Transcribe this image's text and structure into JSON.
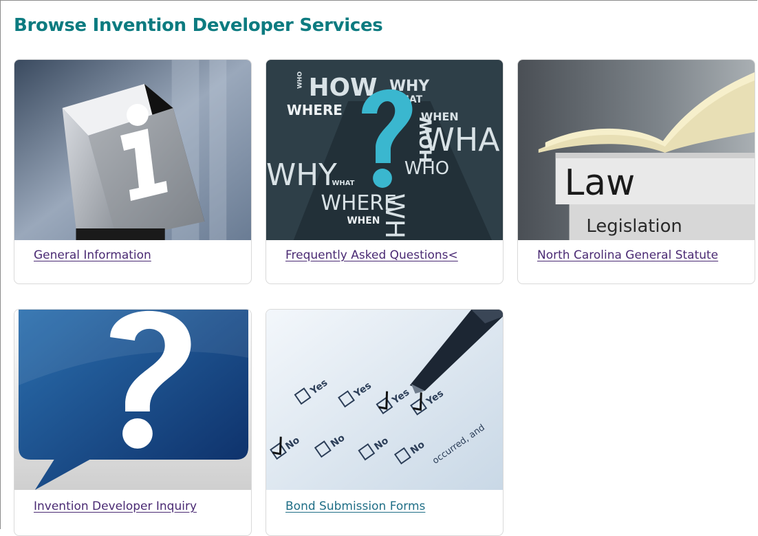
{
  "page": {
    "title": "Browse Invention Developer Services"
  },
  "cards": [
    {
      "label": "General Information",
      "image": "info-cube-image"
    },
    {
      "label": "Frequently Asked Questions<",
      "image": "question-word-cloud-image",
      "image_text": [
        "HOW",
        "WHY",
        "WHAT",
        "WHERE",
        "WHEN",
        "WHO",
        "WHY",
        "WHAT",
        "WHERE",
        "WHEN",
        "WHA",
        "HOW",
        "WHO"
      ]
    },
    {
      "label": "North Carolina General Statute",
      "image": "law-books-image",
      "image_text": [
        "Law",
        "Legislation"
      ]
    },
    {
      "label": "Invention Developer Inquiry",
      "image": "question-speech-bubble-image"
    },
    {
      "label": "Bond Submission Forms",
      "image": "checklist-form-pen-image",
      "image_text": [
        "Yes",
        "No",
        "Yes",
        "No",
        "Yes",
        "No",
        "Yes",
        "No",
        "occurred, and"
      ]
    }
  ],
  "colors": {
    "heading": "#0c7b80",
    "link": "#4a2a73",
    "link_alt": "#1f6e86",
    "card_border": "#d9d9d9"
  }
}
